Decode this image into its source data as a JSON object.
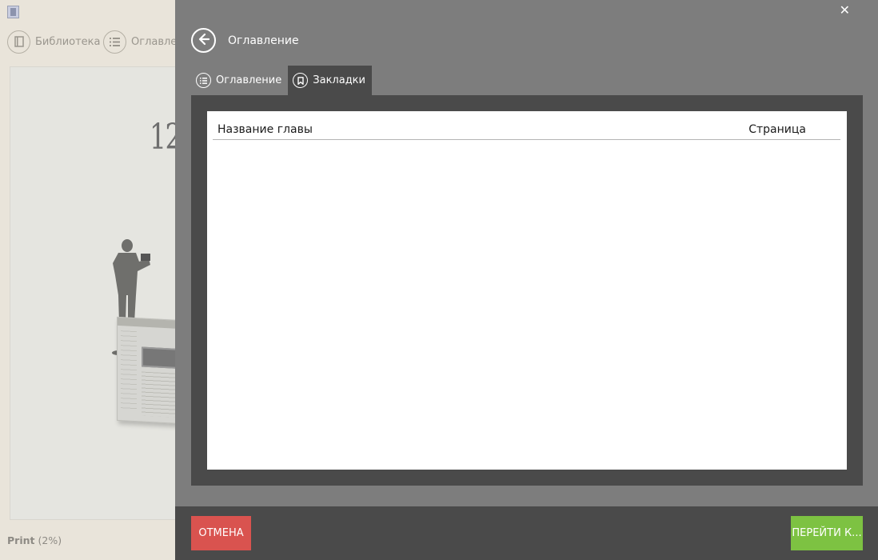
{
  "reader": {
    "toolbar": {
      "library_label": "Библиотека",
      "toc_label": "Оглавлен"
    },
    "page_number": "12",
    "status": {
      "format": "Print",
      "progress_text": "(2%)"
    }
  },
  "modal": {
    "close_glyph": "✕",
    "title": "Оглавление",
    "tabs": [
      {
        "label": "Оглавление",
        "active": false
      },
      {
        "label": "Закладки",
        "active": true
      }
    ],
    "table": {
      "columns": [
        "Название главы",
        "Страница"
      ],
      "rows": []
    },
    "footer": {
      "cancel_label": "ОТМЕНА",
      "go_label": "ПЕРЕЙТИ К..."
    }
  },
  "colors": {
    "cancel": "#d9534f",
    "go": "#7dc242",
    "modal_bg": "#7d7d7d",
    "panel_dark": "#4a4a4a"
  },
  "icons": {
    "back": "arrow-left-icon",
    "toc": "list-icon",
    "bookmarks": "bookmark-icon",
    "library": "book-icon"
  }
}
